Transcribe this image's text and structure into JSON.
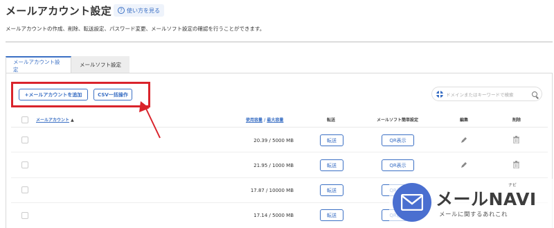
{
  "header": {
    "title": "メールアカウント設定",
    "help_label": "使い方を見る",
    "description": "メールアカウントの作成、削除、転送設定、パスワード変更、メールソフト設定の確認を行うことができます。"
  },
  "tabs": [
    {
      "label": "メールアカウント設定",
      "active": true
    },
    {
      "label": "メールソフト設定",
      "active": false
    }
  ],
  "actions": {
    "add_account_label": "+メールアカウントを追加",
    "csv_label": "CSV一括操作"
  },
  "search": {
    "placeholder": "ドメインまたはキーワードで検索"
  },
  "table": {
    "col_account": "メールアカウント",
    "col_account_sort": "▲",
    "col_usage_used": "使用容量",
    "col_usage_sep": " / ",
    "col_usage_max": "最大容量",
    "col_forward": "転送",
    "col_mailsoft": "メールソフト簡単設定",
    "col_edit": "編集",
    "col_delete": "削除",
    "rows": [
      {
        "account": "",
        "usage": "20.39 / 5000 MB",
        "forward": "転送",
        "qr": "QR表示"
      },
      {
        "account": "",
        "usage": "21.95 / 1000 MB",
        "forward": "転送",
        "qr": "QR表示"
      },
      {
        "account": "",
        "usage": "17.87 / 10000 MB",
        "forward": "転送",
        "qr": "QR表示"
      },
      {
        "account": "",
        "usage": "17.14 / 5000 MB",
        "forward": "転送",
        "qr": "QR表示"
      }
    ]
  },
  "watermark": {
    "name": "メールNAVI",
    "ruby": "ナビ",
    "tagline": "メールに関するあれこれ"
  },
  "colors": {
    "accent": "#3a6fc4",
    "highlight": "#d9232b",
    "logo": "#4a6fd0"
  }
}
